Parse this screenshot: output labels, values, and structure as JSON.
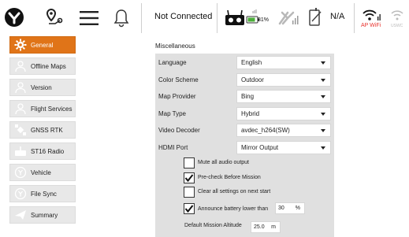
{
  "toolbar": {
    "status": "Not Connected",
    "battery_percent": "81%",
    "gps_status": "N/A",
    "ap_label": "AP WiFi",
    "uswc_label": "USWC"
  },
  "sidebar": {
    "items": [
      {
        "label": "General",
        "icon": "gear-icon",
        "active": true
      },
      {
        "label": "Offline Maps",
        "icon": "map-user-icon",
        "active": false
      },
      {
        "label": "Version",
        "icon": "person-icon",
        "active": false
      },
      {
        "label": "Flight Services",
        "icon": "person-icon",
        "active": false
      },
      {
        "label": "GNSS RTK",
        "icon": "satellite-icon",
        "active": false
      },
      {
        "label": "ST16 Radio",
        "icon": "radio-icon",
        "active": false
      },
      {
        "label": "Vehicle",
        "icon": "drone-icon",
        "active": false
      },
      {
        "label": "File Sync",
        "icon": "drone-icon",
        "active": false
      },
      {
        "label": "Summary",
        "icon": "paper-plane-icon",
        "active": false
      }
    ]
  },
  "main": {
    "section_title": "Miscellaneous",
    "settings": [
      {
        "label": "Language",
        "value": "English"
      },
      {
        "label": "Color Scheme",
        "value": "Outdoor"
      },
      {
        "label": "Map Provider",
        "value": "Bing"
      },
      {
        "label": "Map Type",
        "value": "Hybrid"
      },
      {
        "label": "Video Decoder",
        "value": "avdec_h264(SW)"
      },
      {
        "label": "HDMI Port",
        "value": "Mirror Output"
      }
    ],
    "checkboxes": [
      {
        "label": "Mute all audio output",
        "checked": false
      },
      {
        "label": "Pre-check Before Mission",
        "checked": true
      },
      {
        "label": "Clear all settings on next start",
        "checked": false
      },
      {
        "label": "Announce battery lower than",
        "checked": true
      }
    ],
    "battery_threshold": {
      "value": "30",
      "unit": "%"
    },
    "mission_altitude": {
      "label": "Default Mission Altitude",
      "value": "25.0",
      "unit": "m"
    }
  },
  "colors": {
    "accent": "#e07418",
    "panel_bg": "#e0e0e0",
    "alert_red": "#e8322d",
    "battery_green": "#4caf3a"
  }
}
